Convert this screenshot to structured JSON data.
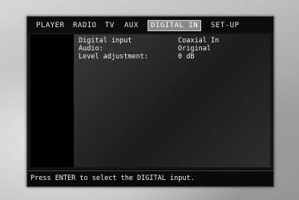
{
  "menu": {
    "tabs": [
      {
        "label": "PLAYER"
      },
      {
        "label": "RADIO"
      },
      {
        "label": "TV"
      },
      {
        "label": "AUX"
      },
      {
        "label": "DIGITAL IN"
      },
      {
        "label": "SET-UP"
      }
    ],
    "active_tab": "DIGITAL IN"
  },
  "settings": {
    "rows": [
      {
        "label": "Digital input",
        "value": "Coaxial In"
      },
      {
        "label": "Audio:",
        "value": "Original"
      },
      {
        "label": "Level adjustment:",
        "value": "0 dB"
      }
    ]
  },
  "status": {
    "message": "Press ENTER to select the DIGITAL input."
  },
  "colors": {
    "screen_bg": "#0c0c0c",
    "active_tab_bg": "#8a8a8a",
    "text": "#f2f2f2"
  }
}
